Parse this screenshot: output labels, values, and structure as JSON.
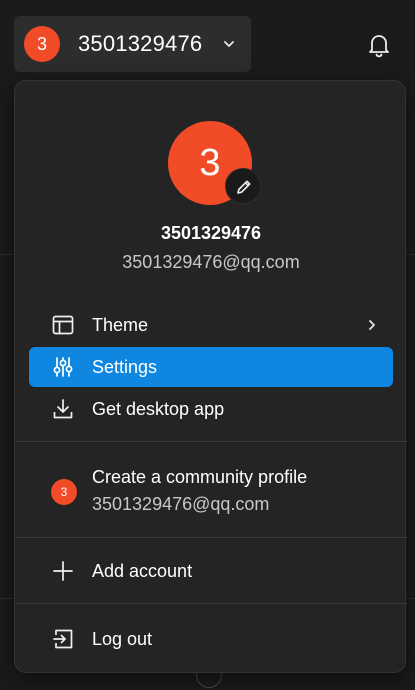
{
  "account": {
    "avatar_letter": "3",
    "name": "3501329476",
    "email": "3501329476@qq.com"
  },
  "menu": {
    "items": [
      {
        "label": "Theme",
        "icon": "layout-icon"
      },
      {
        "label": "Settings",
        "icon": "sliders-icon"
      },
      {
        "label": "Get desktop app",
        "icon": "download-icon"
      }
    ],
    "community": {
      "title": "Create a community profile",
      "subtitle": "3501329476@qq.com"
    },
    "add_account": "Add account",
    "log_out": "Log out"
  },
  "colors": {
    "accent": "#0f86e0",
    "avatar": "#f24b27",
    "background": "#1b1b1b",
    "panel": "#242424"
  }
}
